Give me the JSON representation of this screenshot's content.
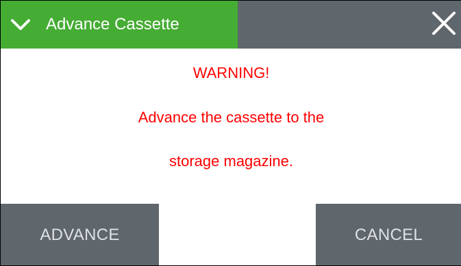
{
  "dialog": {
    "title": "Advance Cassette",
    "collapse_icon": "chevron-down-icon",
    "close_icon": "close-icon"
  },
  "message": {
    "warning": "WARNING!",
    "line1": "Advance the cassette to the",
    "line2": "storage magazine."
  },
  "buttons": {
    "advance_label": "ADVANCE",
    "cancel_label": "CANCEL"
  },
  "colors": {
    "title_tab": "#45ac34",
    "titlebar": "#5f666c",
    "warning_text": "#ff0000",
    "button_bg": "#5f666c",
    "button_text": "#dfe2e4"
  }
}
